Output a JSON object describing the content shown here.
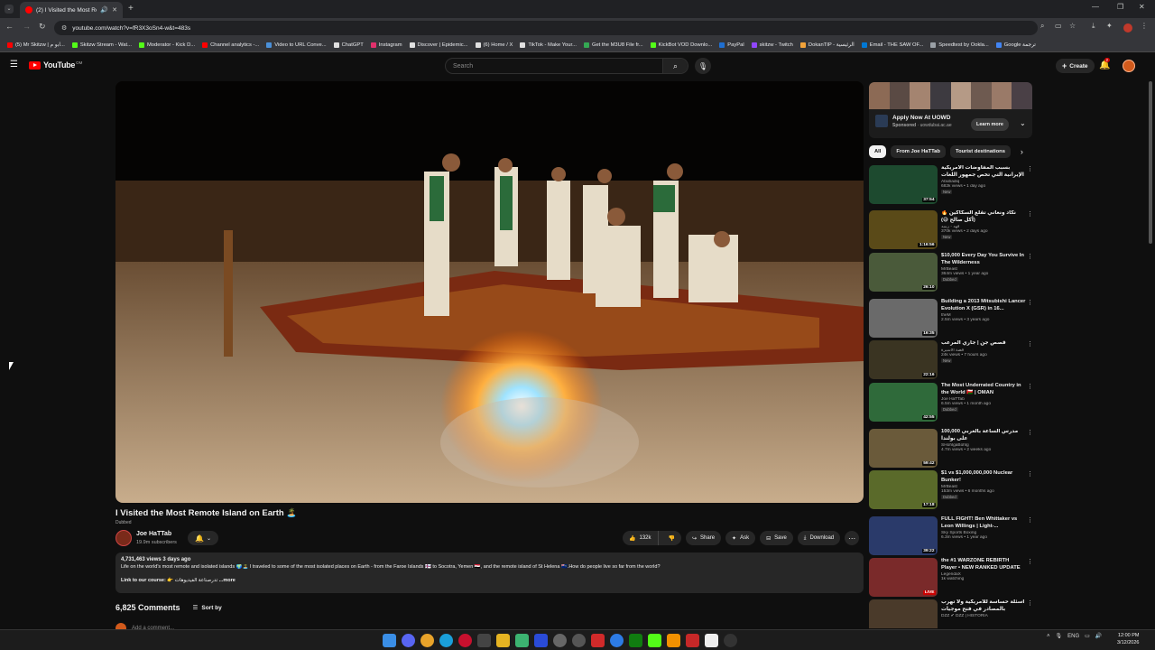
{
  "browser": {
    "tab_title": "(2) I Visited the Most Remo",
    "url": "youtube.com/watch?v=fR3X3oSn4-w&t=483s"
  },
  "bookmarks": [
    {
      "label": "(5) Mr Skitzw | ابو م...",
      "color": "#ff0000"
    },
    {
      "label": "Skitzw Stream - Wat...",
      "color": "#53fc18"
    },
    {
      "label": "Moderator - Kick D...",
      "color": "#53fc18"
    },
    {
      "label": "Channel analytics -...",
      "color": "#ff0000"
    },
    {
      "label": "Video to URL Conve...",
      "color": "#4a90d9"
    },
    {
      "label": "ChatGPT",
      "color": "#e0e0e0"
    },
    {
      "label": "Instagram",
      "color": "#e1306c"
    },
    {
      "label": "Discover | Epidemic...",
      "color": "#e0e0e0"
    },
    {
      "label": "(6) Home / X",
      "color": "#e0e0e0"
    },
    {
      "label": "TikTok - Make Your...",
      "color": "#e0e0e0"
    },
    {
      "label": "Get the M3U8 File fr...",
      "color": "#34a853"
    },
    {
      "label": "KickBot VOD Downlo...",
      "color": "#53fc18"
    },
    {
      "label": "PayPal",
      "color": "#1f6fd1"
    },
    {
      "label": "skitzw - Twitch",
      "color": "#9146ff"
    },
    {
      "label": "DokanTIP - الرئيسية",
      "color": "#f2a33a"
    },
    {
      "label": "Email - THE SAW OF...",
      "color": "#0078d4"
    },
    {
      "label": "Speedtest by Ookla...",
      "color": "#9aa0a6"
    },
    {
      "label": "Google ترجمة",
      "color": "#4285f4"
    }
  ],
  "header": {
    "logo": "YouTube",
    "country": "OM",
    "search_placeholder": "Search",
    "create": "Create",
    "notifications": "2"
  },
  "video": {
    "title": "I Visited the Most Remote Island on Earth 🏝️",
    "dubbed": "Dubbed",
    "channel": "Joe HaTTab",
    "subscribers": "19.9m subscribers",
    "likes": "132k",
    "share": "Share",
    "ask": "Ask",
    "save": "Save",
    "download": "Download"
  },
  "description": {
    "meta": "4,731,463 views  3 days ago",
    "body": "Life on the world's most remote and isolated islands 🌍🏝️ I traveled to some of the most isolated places on Earth - from the Faroe Islands 🇫🇴 to Socotra, Yemen 🇾🇪, and the remote island of St Helena 🇸🇭.How do people live so far from the world?",
    "course_label": "Link to our course:",
    "course_text": "👉 تدرصناعة الفيديوهات",
    "more": "...more"
  },
  "comments": {
    "count": "6,825 Comments",
    "sort": "Sort by",
    "add": "Add a comment..."
  },
  "ad": {
    "title": "Apply Now At UOWD",
    "sponsored": "Sponsored",
    "domain": "uowdubai.ac.ae",
    "cta": "Learn more"
  },
  "chips": [
    "All",
    "From Joe HaTTab",
    "Tourist destinations"
  ],
  "recommendations": [
    {
      "title": "بسبب المفاوضات الأمريكية الإيرانية التي تخص جمهور اللغات القانونية",
      "channel": "Abubadiq",
      "views": "682k views • 1 day ago",
      "badge": "New",
      "duration": "37:54",
      "thumb": "#1d4a2f"
    },
    {
      "title": "نكاد ونعاني تقلع السكاكين 🔥 (أكل صالح 😅)",
      "channel": "فهد - ريبيد",
      "views": "370k views • 2 days ago",
      "badge": "New",
      "duration": "1:16:56",
      "thumb": "#5a4a18"
    },
    {
      "title": "$10,000 Every Day You Survive In The Wilderness",
      "channel": "MrBeast",
      "views": "364m views • 1 year ago",
      "badge": "Dubbed",
      "duration": "26:10",
      "thumb": "#4a5a3a"
    },
    {
      "title": "Building a 2013 Mitsubishi Lancer Evolution X (GSR) in 16...",
      "channel": "theM",
      "views": "2.5m views • 3 years ago",
      "badge": "",
      "duration": "16:35",
      "thumb": "#6a6a6a"
    },
    {
      "title": "قصص جن | جاري المرعب",
      "channel": "قصة الأسيرة",
      "views": "24k views • 7 hours ago",
      "badge": "New",
      "duration": "22:16",
      "thumb": "#3a3422"
    },
    {
      "title": "The Most Underrated Country in the World 🇴🇲 | OMAN",
      "channel": "Joe HaTTab",
      "views": "6.5m views • 1 month ago",
      "badge": "Dubbed",
      "duration": "42:55",
      "thumb": "#2f6a3a"
    },
    {
      "title": "100,000 مدرس الساعة بالعربي على بولندا",
      "channel": "SHohlgaBohlg",
      "views": "4.7m views • 2 weeks ago",
      "badge": "",
      "duration": "59:42",
      "thumb": "#6a5a3a"
    },
    {
      "title": "$1 vs $1,000,000,000 Nuclear Bunker!",
      "channel": "MrBeast",
      "views": "153m views • 6 months ago",
      "badge": "Dubbed",
      "duration": "17:18",
      "thumb": "#5a6a2a"
    },
    {
      "title": "FULL FIGHT! Ben Whittaker vs Leon Willings | Light-...",
      "channel": "Sky Sports Boxing",
      "views": "6.3m views • 1 year ago",
      "badge": "",
      "duration": "39:22",
      "thumb": "#2a3a6a"
    },
    {
      "title": "the #1 WARZONE REBIRTH Player • NEW RANKED UPDATE",
      "channel": "LegendaX",
      "views": "1k watching",
      "badge": "",
      "duration": "LIVE",
      "thumb": "#7a2a2a"
    },
    {
      "title": "أسئلة حساسة للأمريكية ولا تهرب بالمصادر في فتح موجيات",
      "channel": "DZZ ✔ DZZ | HISTORIA",
      "views": "",
      "badge": "",
      "duration": "",
      "thumb": "#4a3a2a"
    }
  ],
  "taskbar": {
    "lang": "ENG",
    "time": "12:00 PM",
    "date": "3/12/2026"
  },
  "colors": {
    "bg": "#0f0f0f",
    "accent": "#ff0000",
    "pill": "#272727"
  }
}
